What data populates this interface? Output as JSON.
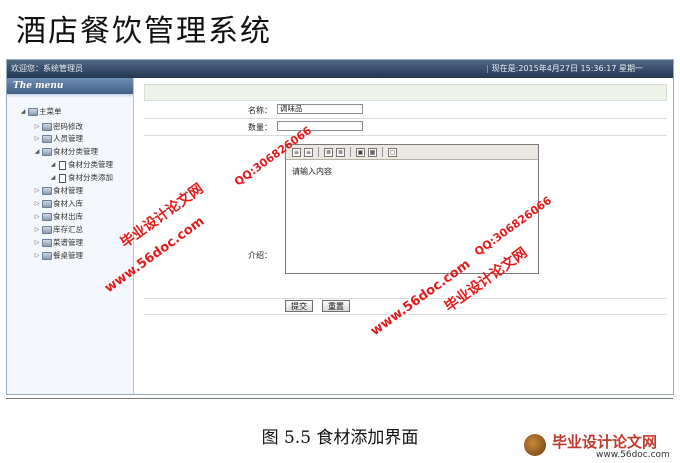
{
  "page_title": "酒店餐饮管理系统",
  "topbar": {
    "welcome": "欢迎您：系统管理员",
    "datetime": "现在是:2015年4月27日 15:36:17 星期一"
  },
  "sidebar": {
    "header": "The menu",
    "items": [
      {
        "label": "主菜单",
        "level": 0,
        "toggle": "◢",
        "icon": "folder-icon"
      },
      {
        "label": "密码修改",
        "level": 1,
        "toggle": "▷",
        "icon": "folder-icon"
      },
      {
        "label": "人员管理",
        "level": 1,
        "toggle": "▷",
        "icon": "folder-icon"
      },
      {
        "label": "食材分类管理",
        "level": 1,
        "toggle": "◢",
        "icon": "folder-icon"
      },
      {
        "label": "食材分类管理",
        "level": 2,
        "toggle": "◢",
        "icon": "document-icon"
      },
      {
        "label": "食材分类添加",
        "level": 2,
        "toggle": "◢",
        "icon": "document-icon"
      },
      {
        "label": "食材管理",
        "level": 1,
        "toggle": "▷",
        "icon": "folder-icon"
      },
      {
        "label": "食材入库",
        "level": 1,
        "toggle": "▷",
        "icon": "folder-icon"
      },
      {
        "label": "食材出库",
        "level": 1,
        "toggle": "▷",
        "icon": "folder-icon"
      },
      {
        "label": "库存汇总",
        "level": 1,
        "toggle": "▷",
        "icon": "folder-icon"
      },
      {
        "label": "菜谱管理",
        "level": 1,
        "toggle": "▷",
        "icon": "folder-icon"
      },
      {
        "label": "餐桌管理",
        "level": 1,
        "toggle": "▷",
        "icon": "folder-icon"
      }
    ]
  },
  "form": {
    "name_label": "名称：",
    "name_value": "调味品",
    "quantity_label": "数量：",
    "quantity_value": "",
    "intro_label": "介绍：",
    "editor_placeholder": "请输入内容",
    "submit_label": "提交",
    "reset_label": "重置"
  },
  "watermarks": {
    "site_cn": "毕业设计论文网",
    "url": "www.56doc.com",
    "qq": "QQ:306826066"
  },
  "caption": "图 5.5  食材添加界面",
  "logo": {
    "text": "毕业设计论文网",
    "url": "www.56doc.com"
  },
  "colors": {
    "topbar": "#2e4563",
    "watermark": "#e31b1b",
    "form_strip": "#eef3ea"
  }
}
